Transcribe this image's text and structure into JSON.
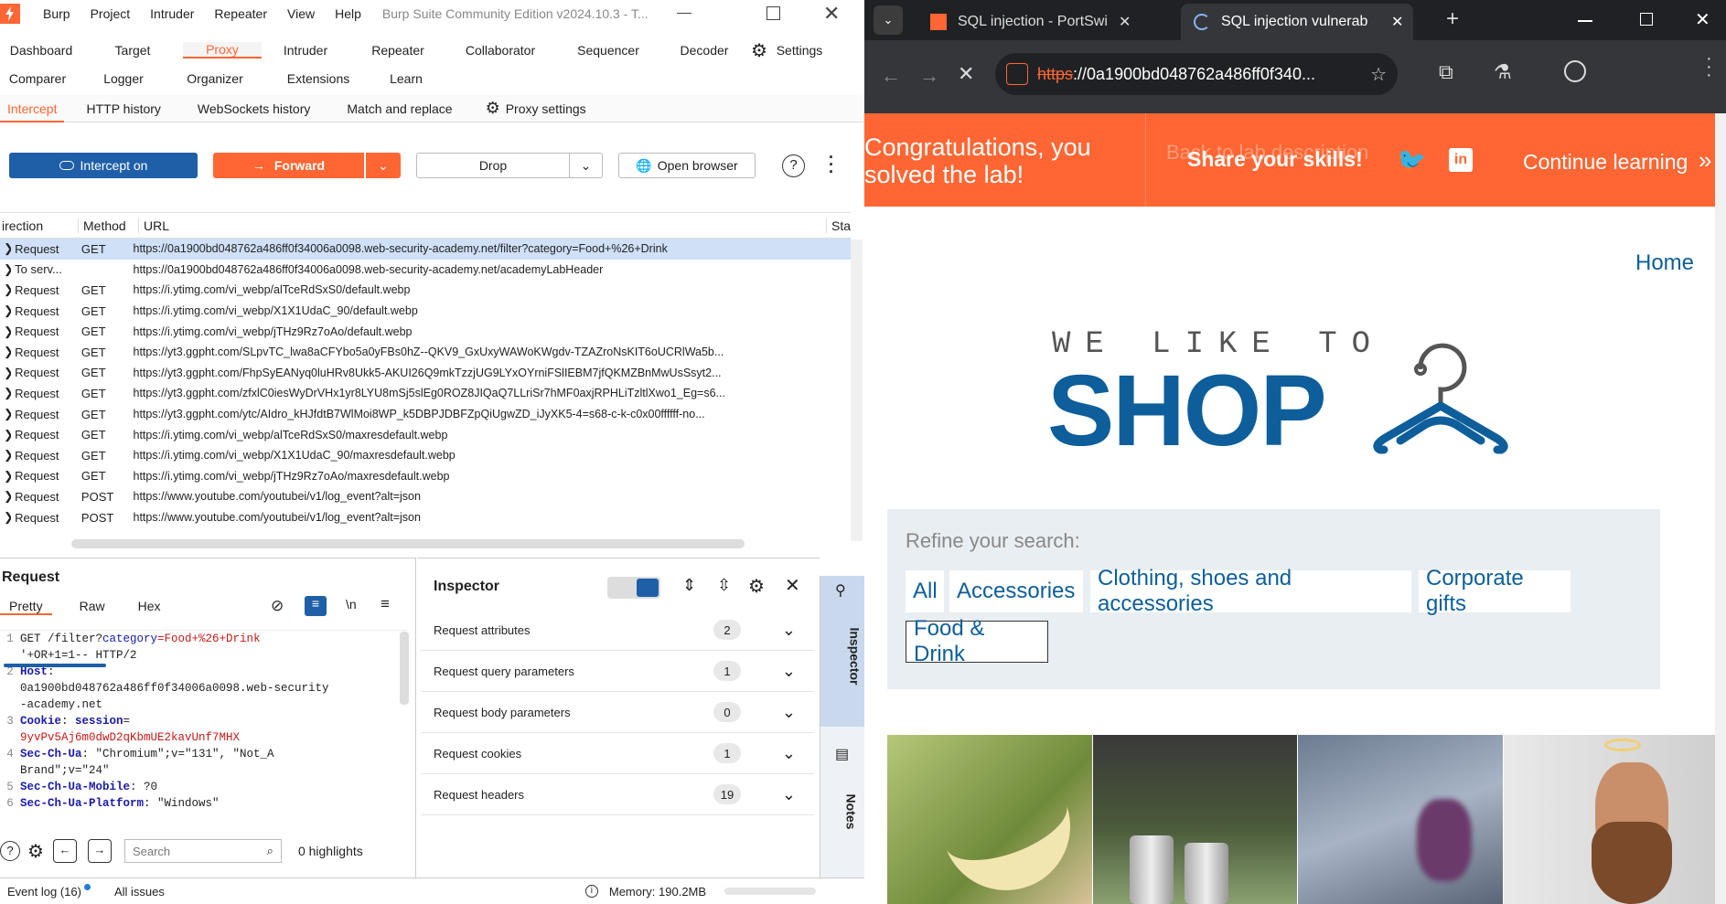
{
  "burp": {
    "menu": [
      "Burp",
      "Project",
      "Intruder",
      "Repeater",
      "View",
      "Help"
    ],
    "title": "Burp Suite Community Edition v2024.10.3 - T...",
    "tabs_row1": [
      "Dashboard",
      "Target",
      "Proxy",
      "Intruder",
      "Repeater",
      "Collaborator",
      "Sequencer",
      "Decoder"
    ],
    "settings_label": "Settings",
    "tabs_row2": [
      "Comparer",
      "Logger",
      "Organizer",
      "Extensions",
      "Learn"
    ],
    "proxy_tabs": [
      "Intercept",
      "HTTP history",
      "WebSockets history",
      "Match and replace"
    ],
    "proxy_settings": "Proxy settings",
    "intercept_btn": "Intercept on",
    "forward_btn": "Forward",
    "drop_btn": "Drop",
    "open_browser_btn": "Open browser",
    "columns": {
      "direction": "irection",
      "method": "Method",
      "url": "URL",
      "status": "Sta"
    },
    "rows": [
      {
        "dir": "Request",
        "method": "GET",
        "url": "https://0a1900bd048762a486ff0f34006a0098.web-security-academy.net/filter?category=Food+%26+Drink"
      },
      {
        "dir": "To serv...",
        "method": "",
        "url": "https://0a1900bd048762a486ff0f34006a0098.web-security-academy.net/academyLabHeader"
      },
      {
        "dir": "Request",
        "method": "GET",
        "url": "https://i.ytimg.com/vi_webp/alTceRdSxS0/default.webp"
      },
      {
        "dir": "Request",
        "method": "GET",
        "url": "https://i.ytimg.com/vi_webp/X1X1UdaC_90/default.webp"
      },
      {
        "dir": "Request",
        "method": "GET",
        "url": "https://i.ytimg.com/vi_webp/jTHz9Rz7oAo/default.webp"
      },
      {
        "dir": "Request",
        "method": "GET",
        "url": "https://yt3.ggpht.com/SLpvTC_lwa8aCFYbo5a0yFBs0hZ--QKV9_GxUxyWAWoKWgdv-TZAZroNsKIT6oUCRlWa5b..."
      },
      {
        "dir": "Request",
        "method": "GET",
        "url": "https://yt3.ggpht.com/FhpSyEANyq0luHRv8Ukk5-AKUI26Q9mkTzzjUG9LYxOYrniFSlIEBM7jfQKMZBnMwUsSsyt2..."
      },
      {
        "dir": "Request",
        "method": "GET",
        "url": "https://yt3.ggpht.com/zfxlC0iesWyDrVHx1yr8LYU8mSj5slEg0ROZ8JIQaQ7LLriSr7hMF0axjRPHLiTzltlXwo1_Eg=s6..."
      },
      {
        "dir": "Request",
        "method": "GET",
        "url": "https://yt3.ggpht.com/ytc/AIdro_kHJfdtB7WlMoi8WP_k5DBPJDBFZpQiUgwZD_iJyXK5-4=s68-c-k-c0x00ffffff-no..."
      },
      {
        "dir": "Request",
        "method": "GET",
        "url": "https://i.ytimg.com/vi_webp/alTceRdSxS0/maxresdefault.webp"
      },
      {
        "dir": "Request",
        "method": "GET",
        "url": "https://i.ytimg.com/vi_webp/X1X1UdaC_90/maxresdefault.webp"
      },
      {
        "dir": "Request",
        "method": "GET",
        "url": "https://i.ytimg.com/vi_webp/jTHz9Rz7oAo/maxresdefault.webp"
      },
      {
        "dir": "Request",
        "method": "POST",
        "url": "https://www.youtube.com/youtubei/v1/log_event?alt=json"
      },
      {
        "dir": "Request",
        "method": "POST",
        "url": "https://www.youtube.com/youtubei/v1/log_event?alt=json"
      }
    ],
    "request_title": "Request",
    "request_tabs": [
      "Pretty",
      "Raw",
      "Hex"
    ],
    "code": [
      {
        "n": "1",
        "a": "GET /filter?",
        "k": "category",
        "b": "=",
        "v": "Food+%26+Drink"
      },
      {
        "n": "",
        "a": "'+OR+1=1-- HTTP/2"
      },
      {
        "n": "2",
        "k": "Host",
        "b": ":"
      },
      {
        "n": "",
        "a": "0a1900bd048762a486ff0f34006a0098.web-security"
      },
      {
        "n": "",
        "a": "-academy.net"
      },
      {
        "n": "3",
        "k": "Cookie",
        "b": ": ",
        "k2": "session",
        "b2": "="
      },
      {
        "n": "",
        "v": "9yvPv5Aj6m0dwD2qKbmUE2kavUnf7MHX"
      },
      {
        "n": "4",
        "k": "Sec-Ch-Ua",
        "a": ": \"Chromium\";v=\"131\", \"Not_A"
      },
      {
        "n": "",
        "a": "Brand\";v=\"24\""
      },
      {
        "n": "5",
        "k": "Sec-Ch-Ua-Mobile",
        "a": ": ?0"
      },
      {
        "n": "6",
        "k": "Sec-Ch-Ua-Platform",
        "a": ": \"Windows\""
      }
    ],
    "search_placeholder": "Search",
    "highlights": "0 highlights",
    "inspector_title": "Inspector",
    "inspector_rows": [
      {
        "label": "Request attributes",
        "count": "2"
      },
      {
        "label": "Request query parameters",
        "count": "1"
      },
      {
        "label": "Request body parameters",
        "count": "0"
      },
      {
        "label": "Request cookies",
        "count": "1"
      },
      {
        "label": "Request headers",
        "count": "19"
      }
    ],
    "side_inspector": "Inspector",
    "side_notes": "Notes",
    "event_log": "Event log (16)",
    "all_issues": "All issues",
    "memory": "Memory: 190.2MB"
  },
  "browser": {
    "tabs": [
      {
        "title": "SQL injection - PortSwi"
      },
      {
        "title": "SQL injection vulnerab"
      }
    ],
    "url_scheme": "https",
    "url_rest": "://0a1900bd048762a486ff0f340...",
    "banner": {
      "congrats": "Congratulations, you solved the lab!",
      "behind": "Back to lab description",
      "share": "Share your skills!",
      "continue": "Continue learning"
    },
    "home_link": "Home",
    "logo_top": "WE LIKE TO",
    "logo_big": "SHOP",
    "refine": "Refine your search:",
    "categories": [
      "All",
      "Accessories",
      "Clothing, shoes and accessories",
      "Corporate gifts",
      "Food & Drink"
    ],
    "colors": {
      "burp_orange": "#ff6633",
      "accent_blue": "#0d5e9a",
      "banner": "#ff6633",
      "intercept_blue": "#1f5fa8"
    }
  }
}
